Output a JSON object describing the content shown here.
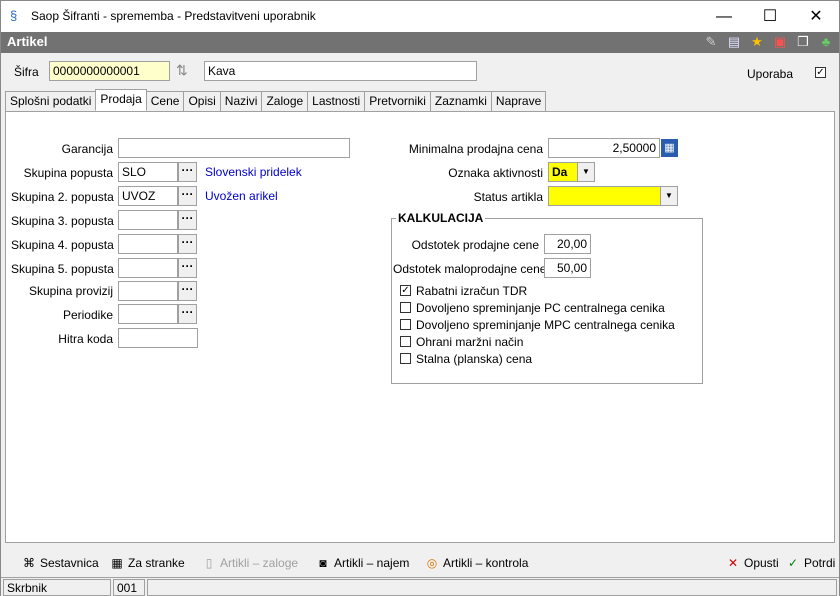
{
  "window": {
    "title": "Saop Šifranti - sprememba - Predstavitveni uporabnik",
    "minimize": "—",
    "maximize": "☐",
    "close": "✕"
  },
  "module": {
    "title": "Artikel"
  },
  "toolbar_icons": [
    "edit-icon",
    "list-icon",
    "star-icon",
    "delete-icon",
    "copy-icon",
    "tree-icon"
  ],
  "header": {
    "code_label": "Šifra",
    "code_value": "0000000000001",
    "name_value": "Kava",
    "usage_label": "Uporaba",
    "usage_checked": "✓"
  },
  "tabs": [
    "Splošni podatki",
    "Prodaja",
    "Cene",
    "Opisi",
    "Nazivi",
    "Zaloge",
    "Lastnosti",
    "Pretvorniki",
    "Zaznamki",
    "Naprave"
  ],
  "left": {
    "guarantee_label": "Garancija",
    "guarantee_value": "",
    "disc_group_label": "Skupina popusta",
    "disc_group_value": "SLO",
    "disc_group_desc": "Slovenski pridelek",
    "disc_group2_label": "Skupina 2. popusta",
    "disc_group2_value": "UVOZ",
    "disc_group2_desc": "Uvožen arikel",
    "disc_group3_label": "Skupina 3. popusta",
    "disc_group4_label": "Skupina 4. popusta",
    "disc_group5_label": "Skupina 5. popusta",
    "commission_label": "Skupina provizij",
    "periodicals_label": "Periodike",
    "quick_code_label": "Hitra koda",
    "dots": "···"
  },
  "right": {
    "min_price_label": "Minimalna prodajna cena",
    "min_price_value": "2,50000",
    "activity_label": "Oznaka aktivnosti",
    "activity_value": "Da",
    "status_label": "Status artikla",
    "status_value": ""
  },
  "calc": {
    "title": "KALKULACIJA",
    "sale_pct_label": "Odstotek prodajne cene",
    "sale_pct_value": "20,00",
    "retail_pct_label": "Odstotek maloprodajne cene",
    "retail_pct_value": "50,00",
    "checkboxes": [
      {
        "label": "Rabatni izračun TDR",
        "checked": "✓"
      },
      {
        "label": "Dovoljeno spreminjanje PC centralnega cenika",
        "checked": ""
      },
      {
        "label": "Dovoljeno spreminjanje MPC centralnega cenika",
        "checked": ""
      },
      {
        "label": "Ohrani maržni način",
        "checked": ""
      },
      {
        "label": "Stalna (planska) cena",
        "checked": ""
      }
    ]
  },
  "bottom": {
    "bill_of_materials": "Sestavnica",
    "for_customers": "Za stranke",
    "item_stock": "Artikli – zaloge",
    "item_rent": "Artikli – najem",
    "item_control": "Artikli – kontrola",
    "cancel": "Opusti",
    "confirm": "Potrdi"
  },
  "statusbar": {
    "cell1": "Skrbnik",
    "cell2": "001",
    "cell3": ""
  }
}
